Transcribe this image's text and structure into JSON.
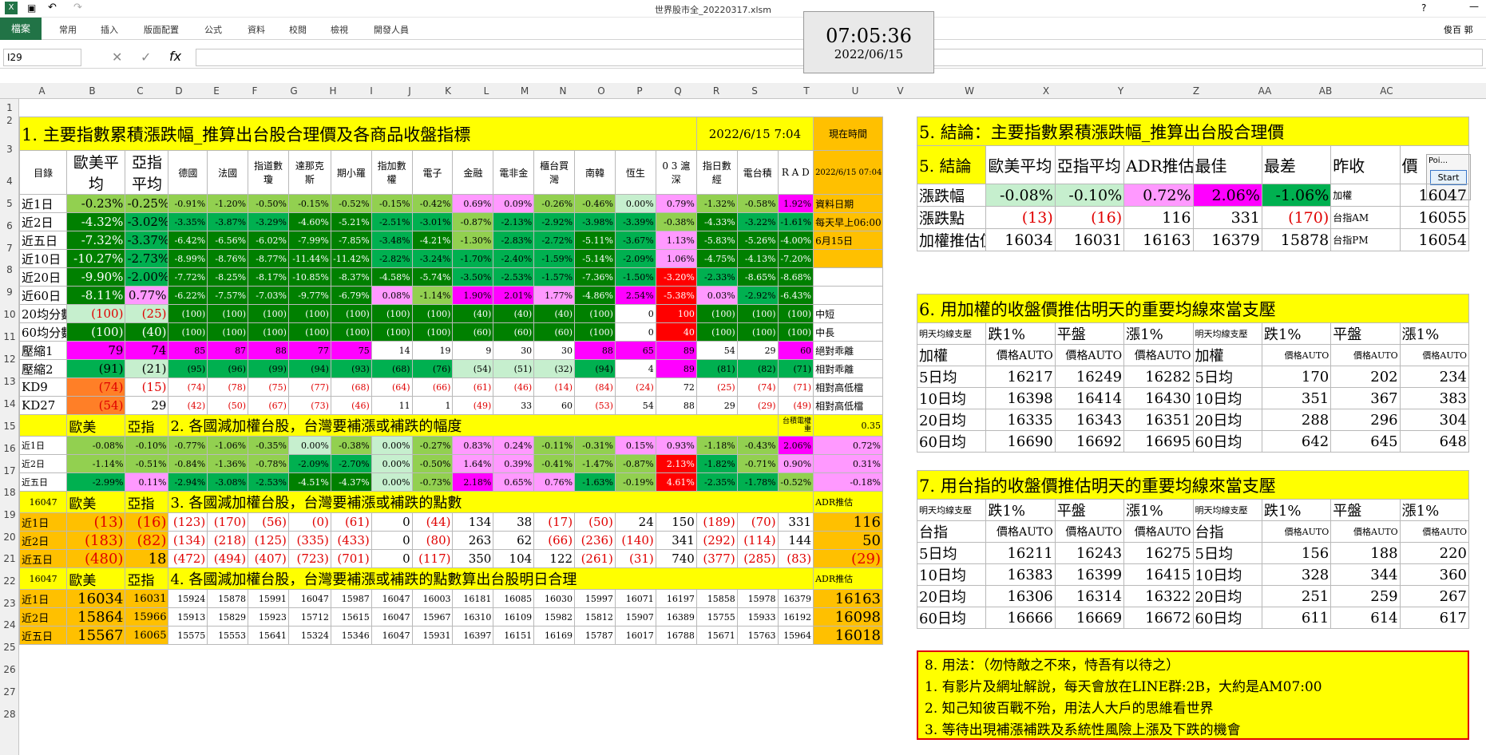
{
  "window": {
    "title": "世界股市全_20220317.xlsm",
    "user": "俊百 郭"
  },
  "ribbon": {
    "file": "檔案",
    "tabs": [
      "常用",
      "插入",
      "版面配置",
      "公式",
      "資料",
      "校閱",
      "檢視",
      "開發人員"
    ]
  },
  "formula": {
    "namebox": "I29",
    "value": ""
  },
  "clock": {
    "time": "07:05:36",
    "date": "2022/06/15"
  },
  "popup": {
    "label": "Poi...",
    "start": "Start"
  },
  "columns": [
    "A",
    "B",
    "C",
    "D",
    "E",
    "F",
    "G",
    "H",
    "I",
    "J",
    "K",
    "L",
    "M",
    "N",
    "O",
    "P",
    "Q",
    "R",
    "S",
    "T",
    "U",
    "V",
    "W",
    "X",
    "Y",
    "Z",
    "AA",
    "AB",
    "AC"
  ],
  "rows": [
    "1",
    "2",
    "3",
    "4",
    "5",
    "6",
    "7",
    "8",
    "9",
    "10",
    "11",
    "12",
    "13",
    "14",
    "15",
    "16",
    "17",
    "18",
    "19",
    "20",
    "21",
    "22",
    "23",
    "24",
    "25",
    "26",
    "27",
    "28"
  ],
  "s1": {
    "title": "1. 主要指數累積漲跌幅_推算出台股合理價及各商品收盤指標",
    "stamp": "2022/6/15 7:04",
    "now_label": "現在時間",
    "headers": [
      "目錄",
      "歐美平均",
      "亞指平均",
      "德國",
      "法國",
      "指道數瓊",
      "達那克斯",
      "期小羅",
      "指加數權",
      "電子",
      "金融",
      "電非金",
      "櫃台買灣",
      "南韓",
      "恆生",
      "0 3 滬深",
      "指日數經",
      "電台積",
      "R A D"
    ],
    "t_col": [
      "2022/6/15 07:04",
      "資料日期",
      "每天早上06:00",
      "6月15日"
    ],
    "rows": [
      [
        "近1日",
        "-0.23%",
        "-0.25%",
        "-0.91%",
        "-1.20%",
        "-0.50%",
        "-0.15%",
        "-0.52%",
        "-0.15%",
        "-0.42%",
        "0.69%",
        "0.09%",
        "-0.26%",
        "-0.46%",
        "0.00%",
        "0.79%",
        "-1.32%",
        "-0.58%",
        "1.92%"
      ],
      [
        "近2日",
        "-4.32%",
        "-3.02%",
        "-3.35%",
        "-3.87%",
        "-3.29%",
        "-4.60%",
        "-5.21%",
        "-2.51%",
        "-3.01%",
        "-0.87%",
        "-2.13%",
        "-2.92%",
        "-3.98%",
        "-3.39%",
        "-0.38%",
        "-4.33%",
        "-3.22%",
        "-1.61%"
      ],
      [
        "近五日",
        "-7.32%",
        "-3.37%",
        "-6.42%",
        "-6.56%",
        "-6.02%",
        "-7.99%",
        "-7.85%",
        "-3.48%",
        "-4.21%",
        "-1.30%",
        "-2.83%",
        "-2.72%",
        "-5.11%",
        "-3.67%",
        "1.13%",
        "-5.83%",
        "-5.26%",
        "-4.00%"
      ],
      [
        "近10日",
        "-10.27%",
        "-2.73%",
        "-8.99%",
        "-8.76%",
        "-8.77%",
        "-11.44%",
        "-11.42%",
        "-2.82%",
        "-3.24%",
        "-1.70%",
        "-2.40%",
        "-1.59%",
        "-5.14%",
        "-2.09%",
        "1.06%",
        "-4.75%",
        "-4.13%",
        "-7.20%"
      ],
      [
        "近20日",
        "-9.90%",
        "-2.00%",
        "-7.72%",
        "-8.25%",
        "-8.17%",
        "-10.85%",
        "-8.37%",
        "-4.58%",
        "-5.74%",
        "-3.50%",
        "-2.53%",
        "-1.57%",
        "-7.36%",
        "-1.50%",
        "-3.20%",
        "-2.33%",
        "-8.65%",
        "-8.68%"
      ],
      [
        "近60日",
        "-8.11%",
        "0.77%",
        "-6.22%",
        "-7.57%",
        "-7.03%",
        "-9.77%",
        "-6.79%",
        "0.08%",
        "-1.14%",
        "1.90%",
        "2.01%",
        "1.77%",
        "-4.86%",
        "2.54%",
        "-5.38%",
        "0.03%",
        "-2.92%",
        "-6.43%"
      ],
      [
        "20均分數",
        "(100)",
        "(25)",
        "(100)",
        "(100)",
        "(100)",
        "(100)",
        "(100)",
        "(100)",
        "(100)",
        "(40)",
        "(40)",
        "(40)",
        "(100)",
        "0",
        "100",
        "(100)",
        "(100)",
        "(100)"
      ],
      [
        "60均分數",
        "(100)",
        "(40)",
        "(100)",
        "(100)",
        "(100)",
        "(100)",
        "(100)",
        "(100)",
        "(100)",
        "(60)",
        "(60)",
        "(60)",
        "(100)",
        "0",
        "40",
        "(100)",
        "(100)",
        "(100)"
      ],
      [
        "壓縮1",
        "79",
        "74",
        "85",
        "87",
        "88",
        "77",
        "75",
        "14",
        "19",
        "9",
        "30",
        "30",
        "88",
        "65",
        "89",
        "54",
        "29",
        "60"
      ],
      [
        "壓縮2",
        "(91)",
        "(21)",
        "(95)",
        "(96)",
        "(99)",
        "(94)",
        "(93)",
        "(68)",
        "(76)",
        "(54)",
        "(51)",
        "(32)",
        "(94)",
        "4",
        "89",
        "(81)",
        "(82)",
        "(71)"
      ],
      [
        "KD9",
        "(74)",
        "(15)",
        "(74)",
        "(78)",
        "(75)",
        "(77)",
        "(68)",
        "(64)",
        "(66)",
        "(61)",
        "(46)",
        "(14)",
        "(84)",
        "(24)",
        "72",
        "(25)",
        "(74)",
        "(71)"
      ],
      [
        "KD27",
        "(54)",
        "29",
        "(42)",
        "(50)",
        "(67)",
        "(73)",
        "(46)",
        "11",
        "1",
        "(49)",
        "33",
        "60",
        "(53)",
        "54",
        "88",
        "29",
        "(29)",
        "(49)"
      ]
    ],
    "row_tags": [
      "中短",
      "中長",
      "絕對乖離",
      "相對乖離",
      "相對高低檔",
      "相對高低檔"
    ]
  },
  "s2": {
    "title": "2. 各國減加權台股，台灣要補漲或補跌的幅度",
    "h1": "歐美",
    "h2": "亞指",
    "s_label": "台積電權重",
    "t_val": "0.35",
    "rows": [
      [
        "近1日",
        "-0.08%",
        "-0.10%",
        "-0.77%",
        "-1.06%",
        "-0.35%",
        "0.00%",
        "-0.38%",
        "0.00%",
        "-0.27%",
        "0.83%",
        "0.24%",
        "-0.11%",
        "-0.31%",
        "0.15%",
        "0.93%",
        "-1.18%",
        "-0.43%",
        "2.06%",
        "0.72%"
      ],
      [
        "近2日",
        "-1.14%",
        "-0.51%",
        "-0.84%",
        "-1.36%",
        "-0.78%",
        "-2.09%",
        "-2.70%",
        "0.00%",
        "-0.50%",
        "1.64%",
        "0.39%",
        "-0.41%",
        "-1.47%",
        "-0.87%",
        "2.13%",
        "-1.82%",
        "-0.71%",
        "0.90%",
        "0.31%"
      ],
      [
        "近五日",
        "-2.99%",
        "0.11%",
        "-2.94%",
        "-3.08%",
        "-2.53%",
        "-4.51%",
        "-4.37%",
        "0.00%",
        "-0.73%",
        "2.18%",
        "0.65%",
        "0.76%",
        "-1.63%",
        "-0.19%",
        "4.61%",
        "-2.35%",
        "-1.78%",
        "-0.52%",
        "-0.18%"
      ]
    ]
  },
  "s3": {
    "title": "3. 各國減加權台股，台灣要補漲或補跌的點數",
    "a_val": "16047",
    "h1": "歐美",
    "h2": "亞指",
    "t_label": "ADR推估",
    "rows": [
      [
        "近1日",
        "(13)",
        "(16)",
        "(123)",
        "(170)",
        "(56)",
        "(0)",
        "(61)",
        "0",
        "(44)",
        "134",
        "38",
        "(17)",
        "(50)",
        "24",
        "150",
        "(189)",
        "(70)",
        "331",
        "116"
      ],
      [
        "近2日",
        "(183)",
        "(82)",
        "(134)",
        "(218)",
        "(125)",
        "(335)",
        "(433)",
        "0",
        "(80)",
        "263",
        "62",
        "(66)",
        "(236)",
        "(140)",
        "341",
        "(292)",
        "(114)",
        "144",
        "50"
      ],
      [
        "近五日",
        "(480)",
        "18",
        "(472)",
        "(494)",
        "(407)",
        "(723)",
        "(701)",
        "0",
        "(117)",
        "350",
        "104",
        "122",
        "(261)",
        "(31)",
        "740",
        "(377)",
        "(285)",
        "(83)",
        "(29)"
      ]
    ]
  },
  "s4": {
    "title": "4. 各國減加權台股，台灣要補漲或補跌的點數算出台股明日合理",
    "a_val": "16047",
    "h1": "歐美",
    "h2": "亞指",
    "t_label": "ADR推估",
    "rows": [
      [
        "近1日",
        "16034",
        "16031",
        "15924",
        "15878",
        "15991",
        "16047",
        "15987",
        "16047",
        "16003",
        "16181",
        "16085",
        "16030",
        "15997",
        "16071",
        "16197",
        "15858",
        "15978",
        "16379",
        "16163"
      ],
      [
        "近2日",
        "15864",
        "15966",
        "15913",
        "15829",
        "15923",
        "15712",
        "15615",
        "16047",
        "15967",
        "16310",
        "16109",
        "15982",
        "15812",
        "15907",
        "16389",
        "15755",
        "15933",
        "16192",
        "16098"
      ],
      [
        "近五日",
        "15567",
        "16065",
        "15575",
        "15553",
        "15641",
        "15324",
        "15346",
        "16047",
        "15931",
        "16397",
        "16151",
        "16169",
        "15787",
        "16017",
        "16788",
        "15671",
        "15763",
        "15964",
        "16018"
      ]
    ]
  },
  "s5": {
    "title": "5. 結論：主要指數累積漲跌幅_推算出台股合理價",
    "headers": [
      "5. 結論",
      "歐美平均",
      "亞指平均",
      "ADR推估",
      "最佳",
      "最差",
      "昨收",
      "價"
    ],
    "rows": [
      [
        "漲跌幅",
        "-0.08%",
        "-0.10%",
        "0.72%",
        "2.06%",
        "-1.06%",
        "加權",
        "16047"
      ],
      [
        "漲跌點",
        "(13)",
        "(16)",
        "116",
        "331",
        "(170)",
        "台指AM",
        "16055"
      ],
      [
        "加權推估值",
        "16034",
        "16031",
        "16163",
        "16379",
        "15878",
        "台指PM",
        "16054"
      ]
    ]
  },
  "s6": {
    "title": "6. 用加權的收盤價推估明天的重要均線來當支壓",
    "h": [
      "明天均線支壓",
      "跌1%",
      "平盤",
      "漲1%",
      "明天均線支壓",
      "跌1%",
      "平盤",
      "漲1%"
    ],
    "rows": [
      [
        "加權",
        "價格AUTO",
        "價格AUTO",
        "價格AUTO",
        "加權",
        "價格AUTO",
        "價格AUTO",
        "價格AUTO"
      ],
      [
        "5日均",
        "16217",
        "16249",
        "16282",
        "5日均",
        "170",
        "202",
        "234"
      ],
      [
        "10日均",
        "16398",
        "16414",
        "16430",
        "10日均",
        "351",
        "367",
        "383"
      ],
      [
        "20日均",
        "16335",
        "16343",
        "16351",
        "20日均",
        "288",
        "296",
        "304"
      ],
      [
        "60日均",
        "16690",
        "16692",
        "16695",
        "60日均",
        "642",
        "645",
        "648"
      ]
    ]
  },
  "s7": {
    "title": "7. 用台指的收盤價推估明天的重要均線來當支壓",
    "h": [
      "明天均線支壓",
      "跌1%",
      "平盤",
      "漲1%",
      "明天均線支壓",
      "跌1%",
      "平盤",
      "漲1%"
    ],
    "rows": [
      [
        "台指",
        "價格AUTO",
        "價格AUTO",
        "價格AUTO",
        "台指",
        "價格AUTO",
        "價格AUTO",
        "價格AUTO"
      ],
      [
        "5日均",
        "16211",
        "16243",
        "16275",
        "5日均",
        "156",
        "188",
        "220"
      ],
      [
        "10日均",
        "16383",
        "16399",
        "16415",
        "10日均",
        "328",
        "344",
        "360"
      ],
      [
        "20日均",
        "16306",
        "16314",
        "16322",
        "20日均",
        "251",
        "259",
        "267"
      ],
      [
        "60日均",
        "16666",
        "16669",
        "16672",
        "60日均",
        "611",
        "614",
        "617"
      ]
    ]
  },
  "s8": {
    "lines": [
      "8. 用法：（勿恃敵之不來，恃吾有以待之）",
      "1. 有影片及網址解說，每天會放在LINE群:2B，大約是AM07:00",
      "2. 知己知彼百戰不殆，用法人大戶的思維看世界",
      "3. 等待出現補漲補跌及系統性風險上漲及下跌的機會"
    ]
  }
}
